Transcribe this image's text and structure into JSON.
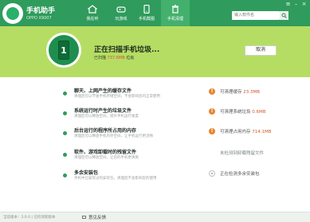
{
  "app": {
    "name": "手机助手",
    "model": "OPPO X9007"
  },
  "tabs": [
    {
      "label": "我在听",
      "icon": "home-icon"
    },
    {
      "label": "玩游戏",
      "icon": "gamepad-icon"
    },
    {
      "label": "手机截图",
      "icon": "phone-icon"
    },
    {
      "label": "手机清理",
      "icon": "trash-icon"
    }
  ],
  "search": {
    "placeholder": "输入软件名"
  },
  "banner": {
    "phone_number": "1",
    "title": "正在扫描手机垃圾...",
    "sub_prefix": "已扫描",
    "sub_size": "737.6MB",
    "sub_suffix": "垃圾",
    "cancel_label": "取消"
  },
  "items": [
    {
      "title": "聊天、上网产生的缓存文件",
      "desc": "清理后可以节省手机存储空间，不会影响您的正常使用",
      "status_prefix": "可清理缓存",
      "status_value": "23.3MB",
      "state": "done"
    },
    {
      "title": "系统运行时产生的垃圾文件",
      "desc": "清理后可以释放空间，提升手机运行速度",
      "status_prefix": "可清理系统垃圾",
      "status_value": "0.6MB",
      "state": "done"
    },
    {
      "title": "后台运行的程序所占用的内存",
      "desc": "清理后可以释放手机内存空间，让手机运行更流畅",
      "status_prefix": "可清理占用内存",
      "status_value": "714.1MB",
      "state": "done"
    },
    {
      "title": "软件、游戏卸载时的残留文件",
      "desc": "清理后可以释放空间，让您的手机更清爽",
      "status_prefix": "未检测到卸载残留文件",
      "status_value": "",
      "state": "none"
    },
    {
      "title": "多余安装包",
      "desc": "手机中已安装过的安装包，清理后不会影响您的使用",
      "status_prefix": "正在检测多余安装包",
      "status_value": "",
      "state": "busy"
    }
  ],
  "footer": {
    "version": "当前版本：3.0.0 | 已检测新版本",
    "feedback": "意见反馈"
  },
  "colors": {
    "header": "#2f9b5c",
    "banner": "#b6dd63",
    "accent": "#d2592d",
    "status": "#e6862f"
  }
}
